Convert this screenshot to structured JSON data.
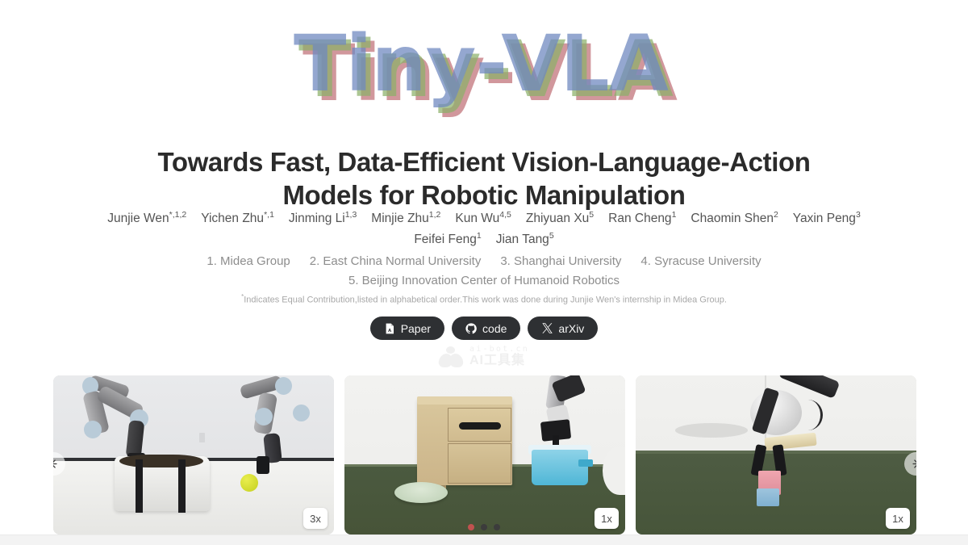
{
  "hero": {
    "title": "Tiny-VLA",
    "layer_colors": {
      "blue": "#6e88c0",
      "green": "#8cb06a",
      "red": "#c47a80"
    }
  },
  "subtitle": {
    "line1": "Towards Fast, Data-Efficient Vision-Language-Action",
    "line2": "Models for Robotic Manipulation"
  },
  "authors": [
    {
      "name": "Junjie Wen",
      "sup": "*,1,2"
    },
    {
      "name": "Yichen Zhu",
      "sup": "*,1"
    },
    {
      "name": "Jinming Li",
      "sup": "1,3"
    },
    {
      "name": "Minjie Zhu",
      "sup": "1,2"
    },
    {
      "name": "Kun Wu",
      "sup": "4,5"
    },
    {
      "name": "Zhiyuan Xu",
      "sup": "5"
    },
    {
      "name": "Ran Cheng",
      "sup": "1"
    },
    {
      "name": "Chaomin Shen",
      "sup": "2"
    },
    {
      "name": "Yaxin Peng",
      "sup": "3"
    },
    {
      "name": "Feifei Feng",
      "sup": "1"
    },
    {
      "name": "Jian Tang",
      "sup": "5"
    }
  ],
  "affiliations": [
    "1. Midea Group",
    "2. East China Normal University",
    "3. Shanghai University",
    "4. Syracuse University",
    "5. Beijing Innovation Center of Humanoid Robotics"
  ],
  "footnote": {
    "star": "*",
    "text": "Indicates Equal Contribution,listed in alphabetical order.This work was done during Junjie Wen's internship in Midea Group."
  },
  "links": [
    {
      "label": "Paper",
      "icon": "pdf-icon"
    },
    {
      "label": "code",
      "icon": "github-icon"
    },
    {
      "label": "arXiv",
      "icon": "x-twitter-icon"
    }
  ],
  "watermark": {
    "en": "ai-bot.cn",
    "cn": "AI工具集"
  },
  "carousel": {
    "panels": [
      {
        "name": "dual-arm-bag-ball",
        "speed_badge": "3x",
        "description": "Two UR robot arms over a white table with a white tote bag and a yellow tennis ball"
      },
      {
        "name": "drawer-plate-bin",
        "speed_badge": "1x",
        "description": "Wooden drawer cabinet, pale green plate and blue storage bin on a dark green table with a robot gripper"
      },
      {
        "name": "block-stacking",
        "speed_badge": "1x",
        "description": "Robot gripper stacking a pink block on a blue block on a dark green table"
      }
    ],
    "prev_label": "←",
    "next_label": "→",
    "dots": [
      {
        "active": true
      },
      {
        "active": false
      },
      {
        "active": false
      }
    ],
    "active_dot_color": "#c0524f"
  }
}
